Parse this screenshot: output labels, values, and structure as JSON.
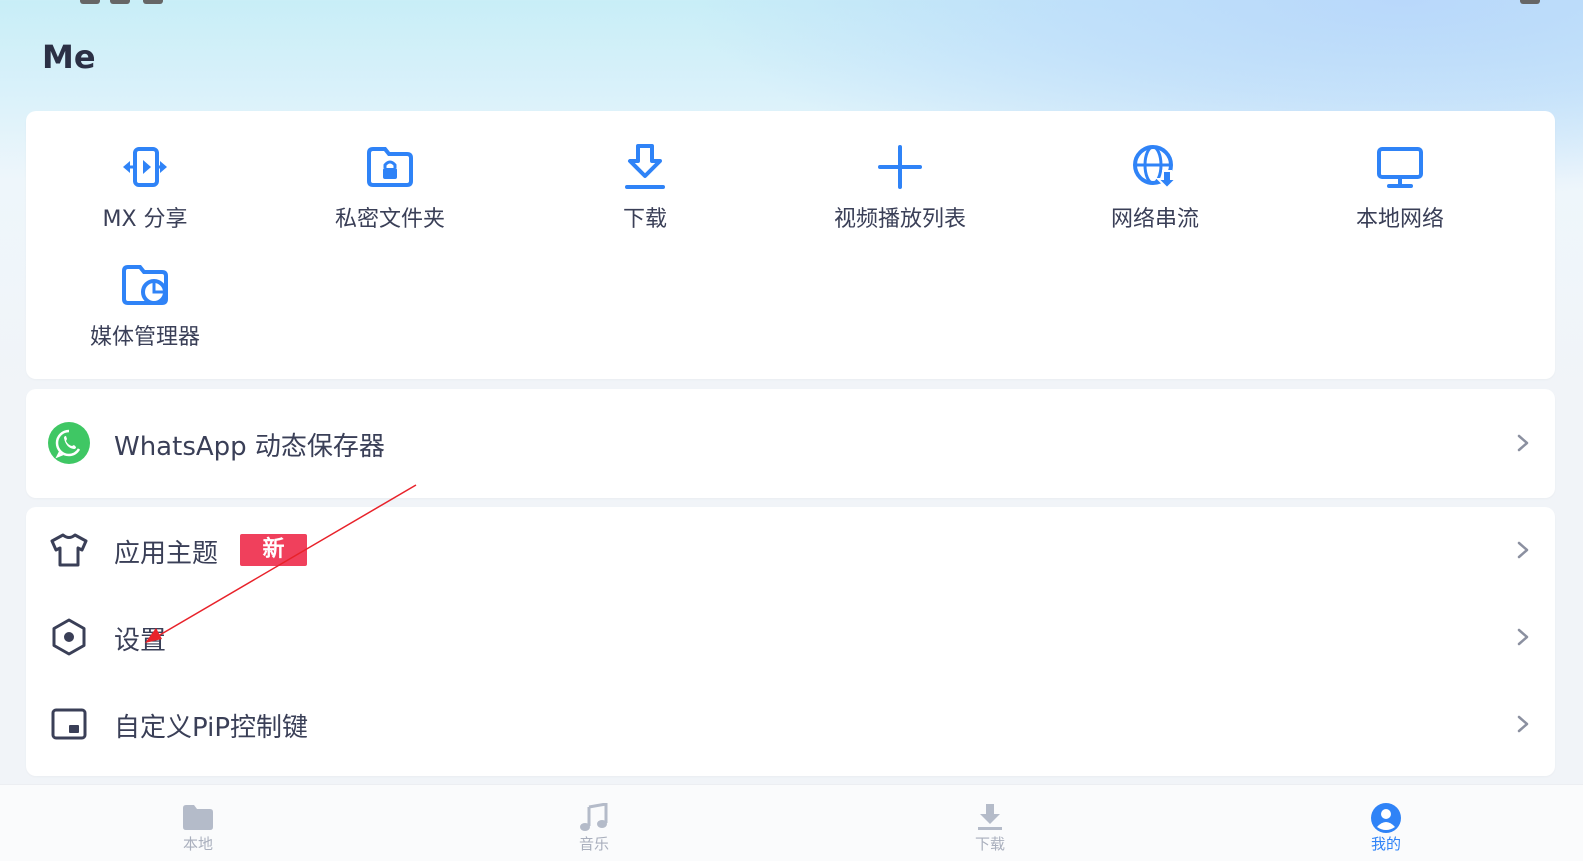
{
  "colors": {
    "accent": "#2f83f7",
    "text": "#3a3f57",
    "badge": "#f0405c",
    "whatsapp": "#3fc764",
    "tab_inactive": "#a9afbd",
    "annotation": "#e8222a"
  },
  "page": {
    "title": "Me"
  },
  "quick_actions": [
    {
      "label": "MX 分享",
      "icon": "mx-share-icon"
    },
    {
      "label": "私密文件夹",
      "icon": "private-folder-icon"
    },
    {
      "label": "下载",
      "icon": "download-icon"
    },
    {
      "label": "视频播放列表",
      "icon": "plus-icon"
    },
    {
      "label": "网络串流",
      "icon": "network-stream-icon"
    },
    {
      "label": "本地网络",
      "icon": "monitor-icon"
    },
    {
      "label": "媒体管理器",
      "icon": "media-manager-icon"
    }
  ],
  "whatsapp": {
    "label": "WhatsApp 动态保存器",
    "icon": "whatsapp-icon"
  },
  "settings_list": [
    {
      "label": "应用主题",
      "icon": "shirt-icon",
      "badge": "新"
    },
    {
      "label": "设置",
      "icon": "settings-hex-icon"
    },
    {
      "label": "自定义PiP控制键",
      "icon": "pip-icon"
    }
  ],
  "bottom_nav": [
    {
      "label": "本地",
      "icon": "folder-icon",
      "active": false
    },
    {
      "label": "音乐",
      "icon": "music-icon",
      "active": false
    },
    {
      "label": "下载",
      "icon": "download-tab-icon",
      "active": false
    },
    {
      "label": "我的",
      "icon": "profile-icon",
      "active": true
    }
  ]
}
